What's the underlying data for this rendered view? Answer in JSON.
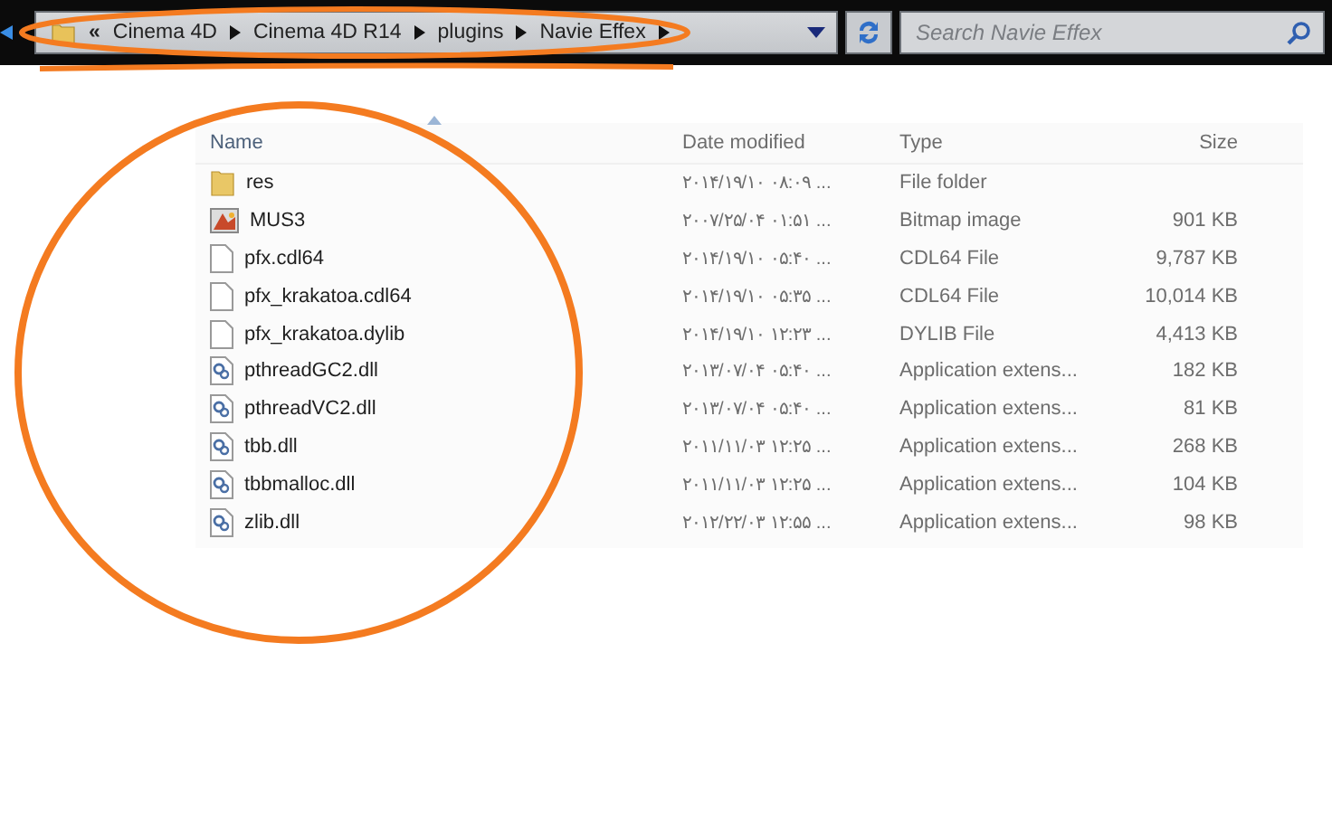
{
  "address_bar": {
    "overflow": "«",
    "crumbs": [
      "Cinema 4D",
      "Cinema 4D R14",
      "plugins",
      "Navie Effex"
    ]
  },
  "search": {
    "placeholder": "Search Navie Effex"
  },
  "table": {
    "columns": [
      "Name",
      "Date modified",
      "Type",
      "Size"
    ],
    "rows": [
      {
        "kind": "folder",
        "name": "res",
        "date": "۲۰۱۴/۱۹/۱۰ ۰۸:۰۹ ...",
        "type": "File folder"
      },
      {
        "kind": "bitmap",
        "name": "MUS3",
        "date": "۲۰۰۷/۲۵/۰۴ ۰۱:۵۱ ...",
        "type": "Bitmap image",
        "size": "901 KB"
      },
      {
        "kind": "file",
        "name": "pfx.cdl64",
        "date": "۲۰۱۴/۱۹/۱۰ ۰۵:۴۰ ...",
        "type": "CDL64 File",
        "size": "9,787 KB"
      },
      {
        "kind": "file",
        "name": "pfx_krakatoa.cdl64",
        "date": "۲۰۱۴/۱۹/۱۰ ۰۵:۳۵ ...",
        "type": "CDL64 File",
        "size": "10,014 KB"
      },
      {
        "kind": "file",
        "name": "pfx_krakatoa.dylib",
        "date": "۲۰۱۴/۱۹/۱۰ ۱۲:۲۳ ...",
        "type": "DYLIB File",
        "size": "4,413 KB"
      },
      {
        "kind": "dll",
        "name": "pthreadGC2.dll",
        "date": "۲۰۱۳/۰۷/۰۴ ۰۵:۴۰ ...",
        "type": "Application extens...",
        "size": "182 KB"
      },
      {
        "kind": "dll",
        "name": "pthreadVC2.dll",
        "date": "۲۰۱۳/۰۷/۰۴ ۰۵:۴۰ ...",
        "type": "Application extens...",
        "size": "81 KB"
      },
      {
        "kind": "dll",
        "name": "tbb.dll",
        "date": "۲۰۱۱/۱۱/۰۳ ۱۲:۲۵ ...",
        "type": "Application extens...",
        "size": "268 KB"
      },
      {
        "kind": "dll",
        "name": "tbbmalloc.dll",
        "date": "۲۰۱۱/۱۱/۰۳ ۱۲:۲۵ ...",
        "type": "Application extens...",
        "size": "104 KB"
      },
      {
        "kind": "dll",
        "name": "zlib.dll",
        "date": "۲۰۱۲/۲۲/۰۳ ۱۲:۵۵ ...",
        "type": "Application extens...",
        "size": "98 KB"
      }
    ]
  }
}
